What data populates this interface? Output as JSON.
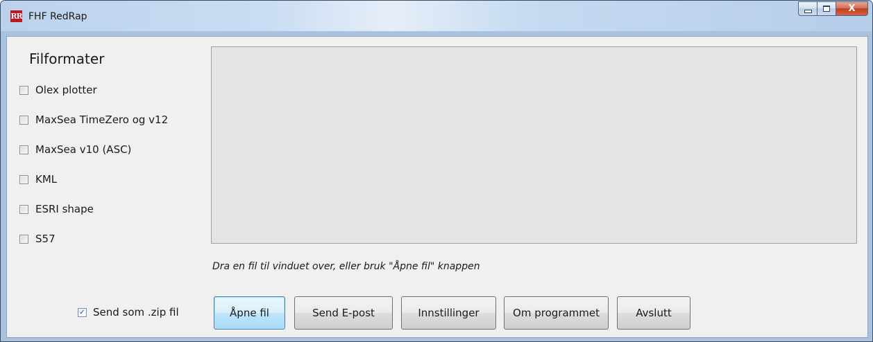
{
  "window": {
    "title": "FHF RedRap",
    "icon_text": "RR",
    "close_glyph": "X"
  },
  "formats": {
    "heading": "Filformater",
    "items": [
      {
        "label": "Olex plotter",
        "checked": false
      },
      {
        "label": "MaxSea TimeZero og v12",
        "checked": false
      },
      {
        "label": "MaxSea v10 (ASC)",
        "checked": false
      },
      {
        "label": "KML",
        "checked": false
      },
      {
        "label": "ESRI shape",
        "checked": false
      },
      {
        "label": "S57",
        "checked": false
      }
    ]
  },
  "zip_option": {
    "label": "Send som .zip fil",
    "checked": true,
    "check_glyph": "✓"
  },
  "hint": "Dra en fil til vinduet over, eller bruk \"Åpne fil\" knappen",
  "buttons": {
    "open": "Åpne fil",
    "email": "Send E-post",
    "settings": "Innstillinger",
    "about": "Om programmet",
    "exit": "Avslutt"
  },
  "colors": {
    "accent_default_button": "#3c7fb1",
    "app_icon": "#c0161d",
    "close_button": "#c2401f"
  }
}
